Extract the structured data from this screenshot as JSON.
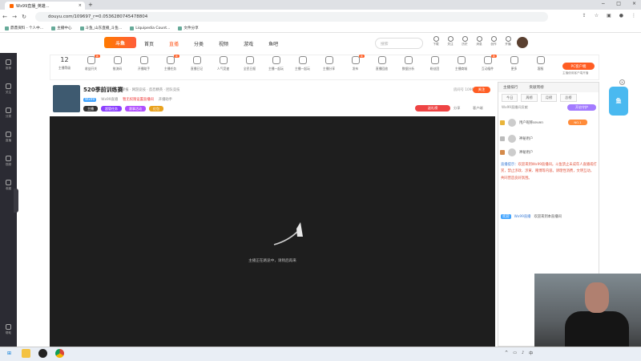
{
  "browser": {
    "tab_title": "Wx99直播_英雄...",
    "tab_close": "×",
    "new_tab": "+",
    "url": "douyu.com/109697_r=0.0536280745478804",
    "window_controls": [
      "−",
      "□",
      "×"
    ],
    "nav": [
      "←",
      "→",
      "↻"
    ],
    "bookmarks": [
      "鼎鼎资料 - 个人中...",
      "主播中心",
      "斗鱼_山东直播_斗鱼...",
      "Liquipedia Count...",
      "文件分享"
    ]
  },
  "site": {
    "logo": "斗鱼",
    "nav": [
      "首页",
      "直播",
      "分类",
      "视频",
      "游戏",
      "鱼吧"
    ],
    "active_nav": "直播",
    "search_placeholder": "搜索",
    "header_icons": [
      {
        "name": "download-icon",
        "label": "下载"
      },
      {
        "name": "heart-icon",
        "label": "关注"
      },
      {
        "name": "history-icon",
        "label": "历史"
      },
      {
        "name": "message-icon",
        "label": "消息"
      },
      {
        "name": "upload-icon",
        "label": "创作"
      },
      {
        "name": "bell-icon",
        "label": "开播"
      }
    ]
  },
  "sidebar": {
    "items": [
      "推荐",
      "关注",
      "分类",
      "直播",
      "视频",
      "收藏"
    ],
    "bottom": "帮助"
  },
  "toolbar": {
    "level": "12",
    "level_label": "主播等级",
    "items": [
      {
        "label": "收益开关",
        "badge": "新"
      },
      {
        "label": "推流码",
        "badge": ""
      },
      {
        "label": "开播助手",
        "badge": ""
      },
      {
        "label": "主播任务",
        "badge": "新"
      },
      {
        "label": "直播日记",
        "badge": ""
      },
      {
        "label": "人气竞速",
        "badge": ""
      },
      {
        "label": "全民日报",
        "badge": ""
      },
      {
        "label": "主播一起玩",
        "badge": ""
      },
      {
        "label": "主播一起玩",
        "badge": ""
      },
      {
        "label": "主播分享",
        "badge": ""
      },
      {
        "label": "发布",
        "badge": "新"
      },
      {
        "label": "直播回放",
        "badge": ""
      },
      {
        "label": "数据分析",
        "badge": ""
      },
      {
        "label": "粉丝团",
        "badge": ""
      },
      {
        "label": "主播商城",
        "badge": ""
      },
      {
        "label": "互动插件",
        "badge": "新"
      },
      {
        "label": "更多",
        "badge": ""
      },
      {
        "label": "客服",
        "badge": ""
      }
    ],
    "pc_button": "PC客户端",
    "pc_sub": "主播使用客户端开播"
  },
  "room": {
    "title": "520季前训练赛",
    "meta": "举报 · 网游竞技 · 反恐精英 · 团队竞技",
    "report": "举报",
    "room_no": "房间号 109697",
    "follow": "关注",
    "tag": "Wx99",
    "uid_label": "Wx99直播",
    "warning": "暂无权限设置直播间",
    "extra": "开播助手",
    "pills": [
      {
        "label": "主播",
        "color": "#333"
      },
      {
        "label": "超管任务",
        "color": "#8b3fff"
      },
      {
        "label": "赛事活动",
        "color": "#b04fff"
      },
      {
        "label": "红包",
        "color": "#e9a21e"
      }
    ],
    "rank_btn": "送礼榜",
    "share": "分享",
    "client": "客户端",
    "loading_tip": "主播正在路途中，请稍后再来"
  },
  "panel": {
    "tabs": [
      "主播排行",
      "贡献周榜"
    ],
    "rank_tabs": [
      "今日",
      "周榜",
      "月榜",
      "总榜"
    ],
    "sub": "Wx99直播间贡献",
    "purple_btn": "开启守护",
    "rows": [
      {
        "name": "用户昵称seven",
        "rank": "1"
      },
      {
        "name": "神秘用户",
        "rank": "2"
      },
      {
        "name": "神秘用户",
        "rank": "3"
      }
    ],
    "r1_badge": "NO.1",
    "notice_label": "直播提示：",
    "notice_text": "欢迎来到Wx99直播间。斗鱼禁止未成年人直播或打赏，禁止涉政、涉黄、赌博等内容。请理性消费，文明互动，共同营造良好氛围。",
    "welcome_badge": "欢迎",
    "welcome_user": "Wx99直播",
    "welcome_text": "欢迎来到本直播间"
  },
  "floating": {
    "mascot": "鱼",
    "close": "×"
  },
  "taskbar": {
    "icons": [
      "start",
      "files",
      "obs",
      "chrome"
    ],
    "time": "20:23"
  }
}
